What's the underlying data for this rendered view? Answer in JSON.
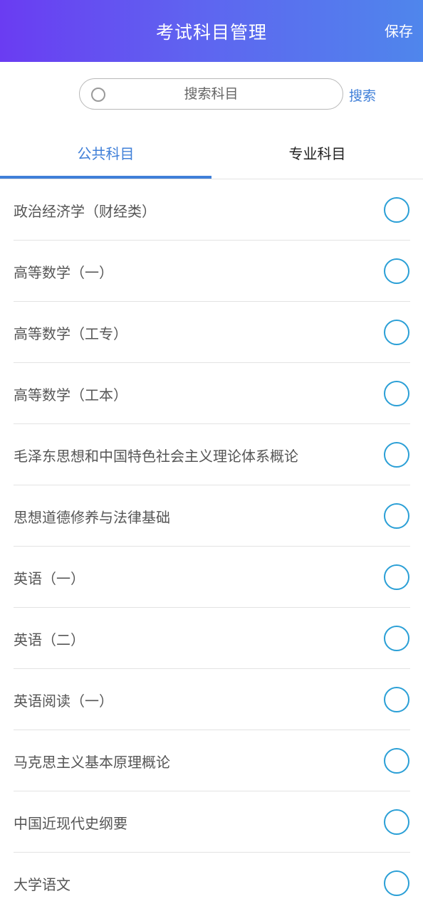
{
  "header": {
    "title": "考试科目管理",
    "save_label": "保存"
  },
  "search": {
    "placeholder": "搜索科目",
    "button_label": "搜索"
  },
  "tabs": [
    {
      "label": "公共科目",
      "active": true
    },
    {
      "label": "专业科目",
      "active": false
    }
  ],
  "subjects": [
    {
      "label": "政治经济学（财经类）",
      "selected": false
    },
    {
      "label": "高等数学（一）",
      "selected": false
    },
    {
      "label": "高等数学（工专）",
      "selected": false
    },
    {
      "label": "高等数学（工本）",
      "selected": false
    },
    {
      "label": "毛泽东思想和中国特色社会主义理论体系概论",
      "selected": false
    },
    {
      "label": "思想道德修养与法律基础",
      "selected": false
    },
    {
      "label": "英语（一）",
      "selected": false
    },
    {
      "label": "英语（二）",
      "selected": false
    },
    {
      "label": "英语阅读（一）",
      "selected": false
    },
    {
      "label": "马克思主义基本原理概论",
      "selected": false
    },
    {
      "label": "中国近现代史纲要",
      "selected": false
    },
    {
      "label": "大学语文",
      "selected": false
    }
  ],
  "colors": {
    "header_gradient_start": "#6a3cf2",
    "header_gradient_end": "#4f86ec",
    "accent": "#3f7fd8",
    "radio_border": "#2a9fd6"
  }
}
